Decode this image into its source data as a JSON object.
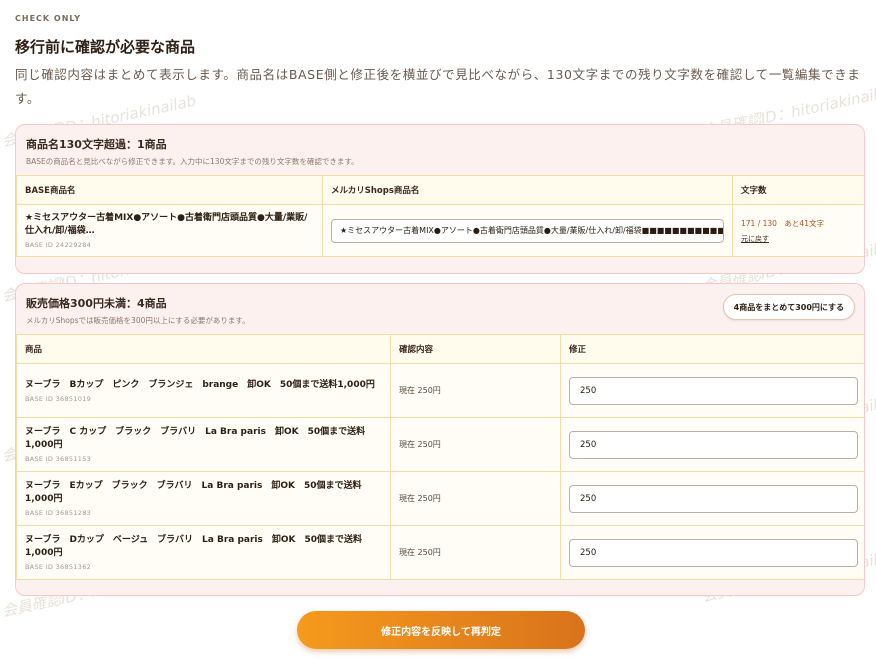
{
  "watermark": "会員確認ID：hitoriakinailab",
  "header": {
    "eyebrow": "CHECK ONLY",
    "title": "移行前に確認が必要な商品",
    "description": "同じ確認内容はまとめて表示します。商品名はBASE側と修正後を横並びで見比べながら、130文字までの残り文字数を確認して一覧編集できます。"
  },
  "long_names": {
    "title": "商品名130文字超過：1商品",
    "note": "BASEの商品名と見比べながら修正できます。入力中に130文字までの残り文字数を確認できます。",
    "columns": [
      "BASE商品名",
      "メルカリShops商品名",
      "文字数"
    ],
    "rows": [
      {
        "base_name": "★ミセスアウター古着MIX●アソート●古着衛門店頭品質●大量/業販/仕入れ/卸/福袋…",
        "base_id": "BASE ID 24229284",
        "shops_name": "★ミセスアウター古着MIX●アソート●古着衛門店頭品質●大量/業販/仕入れ/卸/福袋■■■■■■■■■■■■■■",
        "count": "171 / 130　あと41文字",
        "reset_label": "元に戻す"
      }
    ]
  },
  "low_price": {
    "title": "販売価格300円未満：4商品",
    "note": "メルカリShopsでは販売価格を300円以上にする必要があります。",
    "bulk_button": "4商品をまとめて300円にする",
    "columns": [
      "商品",
      "確認内容",
      "修正"
    ],
    "rows": [
      {
        "name": "ヌーブラ　Bカップ　ピンク　ブランジェ　brange　卸OK　50個まで送料1,000円",
        "base_id": "BASE ID 36851019",
        "current": "現在 250円",
        "value": "250"
      },
      {
        "name": "ヌーブラ　C カップ　ブラック　ブラバリ　La Bra paris　卸OK　50個まで送料1,000円",
        "base_id": "BASE ID 36851153",
        "current": "現在 250円",
        "value": "250"
      },
      {
        "name": "ヌーブラ　Eカップ　ブラック　ブラバリ　La Bra paris　卸OK　50個まで送料1,000円",
        "base_id": "BASE ID 36851283",
        "current": "現在 250円",
        "value": "250"
      },
      {
        "name": "ヌーブラ　Dカップ　ベージュ　ブラバリ　La Bra paris　卸OK　50個まで送料1,000円",
        "base_id": "BASE ID 36851362",
        "current": "現在 250円",
        "value": "250"
      }
    ]
  },
  "footer": {
    "submit_label": "修正内容を反映して再判定"
  }
}
